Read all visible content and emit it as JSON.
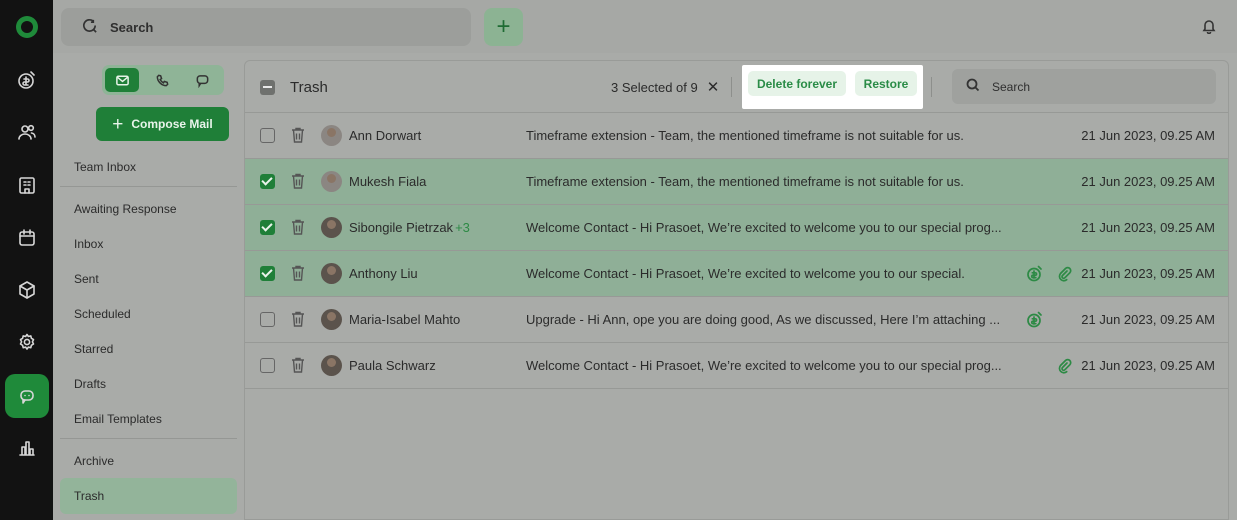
{
  "top": {
    "search_label": "Search",
    "add_symbol": "+"
  },
  "mailnav": {
    "compose_label": "Compose Mail",
    "items": [
      "Team Inbox",
      "Awaiting Response",
      "Inbox",
      "Sent",
      "Scheduled",
      "Starred",
      "Drafts",
      "Email Templates",
      "Archive",
      "Trash"
    ],
    "active": "Trash"
  },
  "panel": {
    "title": "Trash",
    "selection_text": "3 Selected of 9",
    "clear_symbol": "✕",
    "delete_forever_label": "Delete forever",
    "restore_label": "Restore",
    "search_placeholder": "Search"
  },
  "rows": [
    {
      "name": "Ann Dorwart",
      "extra": "",
      "message": "Timeframe extension  -  Team, the mentioned timeframe is not suitable for us.",
      "date": "21 Jun 2023, 09.25 AM",
      "selected": false,
      "icons": []
    },
    {
      "name": "Mukesh Fiala",
      "extra": "",
      "message": "Timeframe extension  -  Team, the mentioned timeframe is not suitable for us.",
      "date": "21 Jun 2023, 09.25 AM",
      "selected": true,
      "icons": []
    },
    {
      "name": "Sibongile Pietrzak",
      "extra": "+3",
      "message": "Welcome Contact  -  Hi Prasoet, We’re excited to welcome you to our special prog...",
      "date": "21 Jun 2023, 09.25 AM",
      "selected": true,
      "icons": []
    },
    {
      "name": "Anthony Liu",
      "extra": "",
      "message": "Welcome Contact  -  Hi Prasoet, We’re excited to welcome you to our special.",
      "date": "21 Jun 2023, 09.25 AM",
      "selected": true,
      "icons": [
        "deal-icon",
        "attachment-icon"
      ]
    },
    {
      "name": "Maria-Isabel Mahto",
      "extra": "",
      "message": "Upgrade  -  Hi Ann, ope you are doing good, As we discussed, Here I’m attaching ...",
      "date": "21 Jun 2023, 09.25 AM",
      "selected": false,
      "icons": [
        "deal-icon"
      ]
    },
    {
      "name": "Paula Schwarz",
      "extra": "",
      "message": "Welcome Contact  -  Hi Prasoet, We’re excited to welcome you to our special prog...",
      "date": "21 Jun 2023, 09.25 AM",
      "selected": false,
      "icons": [
        "attachment-icon"
      ]
    }
  ],
  "colors": {
    "brand_green": "#1f7f38",
    "selected_row": "#8faf97",
    "action_text": "#2a8c47"
  }
}
